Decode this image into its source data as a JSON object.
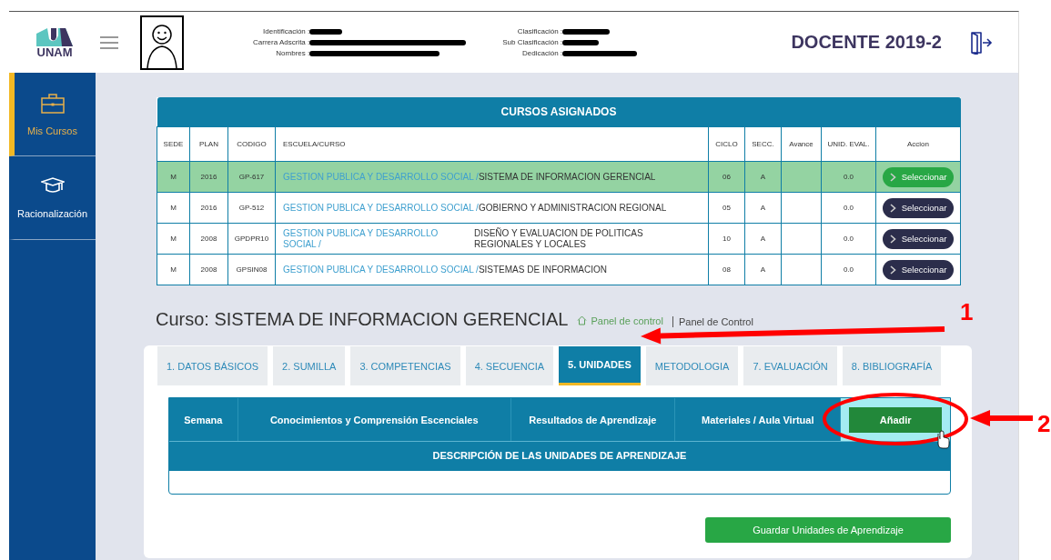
{
  "header": {
    "logo_text": "UNAM",
    "info_left": [
      {
        "label": "Identificación :"
      },
      {
        "label": "Carrera Adscrita :"
      },
      {
        "label": "Nombres :"
      }
    ],
    "info_right": [
      {
        "label": "Clasificación :"
      },
      {
        "label": "Sub Clasificación :"
      },
      {
        "label": "Dedicación :"
      }
    ],
    "role_title": "DOCENTE 2019-2"
  },
  "sidebar": {
    "items": [
      {
        "label": "Mis Cursos",
        "selected": true
      },
      {
        "label": "Racionalización",
        "selected": false
      }
    ]
  },
  "courses_table": {
    "title": "CURSOS ASIGNADOS",
    "columns": [
      "SEDE",
      "PLAN",
      "CODIGO",
      "ESCUELA/CURSO",
      "CICLO",
      "SECC.",
      "Avance",
      "UNID. EVAL.",
      "Accion"
    ],
    "rows": [
      {
        "sede": "M",
        "plan": "2016",
        "codigo": "GP-617",
        "escuela": "GESTION PUBLICA Y DESARROLLO SOCIAL /",
        "curso": "SISTEMA DE INFORMACION GERENCIAL",
        "ciclo": "06",
        "secc": "A",
        "unid_eval": "0.0",
        "action": "Seleccionar",
        "selected": true
      },
      {
        "sede": "M",
        "plan": "2016",
        "codigo": "GP-512",
        "escuela": "GESTION PUBLICA Y DESARROLLO SOCIAL /",
        "curso": "GOBIERNO Y ADMINISTRACION REGIONAL",
        "ciclo": "05",
        "secc": "A",
        "unid_eval": "0.0",
        "action": "Seleccionar",
        "selected": false
      },
      {
        "sede": "M",
        "plan": "2008",
        "codigo": "GPDPR10",
        "escuela": "GESTION PUBLICA Y DESARROLLO SOCIAL /",
        "curso": "DISEÑO Y EVALUACION DE POLITICAS REGIONALES Y LOCALES",
        "ciclo": "10",
        "secc": "A",
        "unid_eval": "0.0",
        "action": "Seleccionar",
        "selected": false
      },
      {
        "sede": "M",
        "plan": "2008",
        "codigo": "GPSIN08",
        "escuela": "GESTION PUBLICA Y DESARROLLO SOCIAL /",
        "curso": "SISTEMAS DE INFORMACION",
        "ciclo": "08",
        "secc": "A",
        "unid_eval": "0.0",
        "action": "Seleccionar",
        "selected": false
      }
    ]
  },
  "course": {
    "title": "Curso: SISTEMA DE INFORMACION GERENCIAL",
    "breadcrumb": [
      "Panel de control",
      "Panel de Control"
    ]
  },
  "tabs": [
    {
      "label": "1. DATOS BÁSICOS",
      "selected": false
    },
    {
      "label": "2. SUMILLA",
      "selected": false
    },
    {
      "label": "3. COMPETENCIAS",
      "selected": false
    },
    {
      "label": "4. SECUENCIA",
      "selected": false
    },
    {
      "label": "5. UNIDADES",
      "selected": true
    },
    {
      "label": "METODOLOGIA",
      "selected": false
    },
    {
      "label": "7. EVALUACIÓN",
      "selected": false
    },
    {
      "label": "8. BIBLIOGRAFÍA",
      "selected": false
    }
  ],
  "units_table": {
    "columns": [
      "Semana",
      "Conocimientos y Comprensión Escenciales",
      "Resultados de Aprendizaje",
      "Materiales / Aula Virtual"
    ],
    "add_button": "Añadir",
    "description_header": "DESCRIPCIÓN DE LAS UNIDADES DE APRENDIZAJE"
  },
  "save_button": "Guardar Unidades de Aprendizaje",
  "annotations": [
    {
      "kind": "arrow",
      "label": "1"
    },
    {
      "kind": "circle"
    },
    {
      "kind": "arrow",
      "label": "2"
    }
  ]
}
